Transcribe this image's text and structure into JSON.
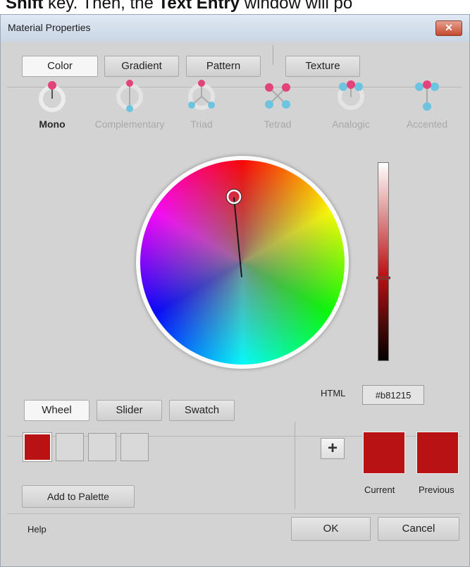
{
  "top_text": {
    "bold1": "Shift",
    "plain1": " key. Then, the ",
    "bold2": "Text Entry",
    "plain2": " window will po"
  },
  "window": {
    "title": "Material Properties",
    "close_glyph": "✕"
  },
  "tabs": [
    {
      "label": "Color",
      "active": true
    },
    {
      "label": "Gradient"
    },
    {
      "label": "Pattern"
    },
    {
      "label": "Texture"
    }
  ],
  "harmonies": [
    {
      "label": "Mono",
      "active": true,
      "icon": "mono-icon"
    },
    {
      "label": "Complementary",
      "icon": "complementary-icon"
    },
    {
      "label": "Triad",
      "icon": "triad-icon"
    },
    {
      "label": "Tetrad",
      "icon": "tetrad-icon"
    },
    {
      "label": "Analogic",
      "icon": "analogic-icon"
    },
    {
      "label": "Accented",
      "icon": "accented-icon"
    }
  ],
  "modes": [
    {
      "label": "Wheel",
      "active": true
    },
    {
      "label": "Slider"
    },
    {
      "label": "Swatch"
    }
  ],
  "html": {
    "label": "HTML",
    "value": "#b81215"
  },
  "palette": {
    "add_label": "Add to Palette",
    "slots": [
      "#b81215",
      "",
      "",
      ""
    ]
  },
  "plus_glyph": "+",
  "current": {
    "label": "Current",
    "color": "#b81215"
  },
  "previous": {
    "label": "Previous",
    "color": "#b81215"
  },
  "footer": {
    "help": "Help",
    "ok": "OK",
    "cancel": "Cancel"
  },
  "colors": {
    "accent": "#b81215",
    "window_bg": "#d3d3d3",
    "pink_dot": "#e2437a",
    "cyan_dot": "#6cc4e0"
  },
  "luminance_level": 0.58
}
